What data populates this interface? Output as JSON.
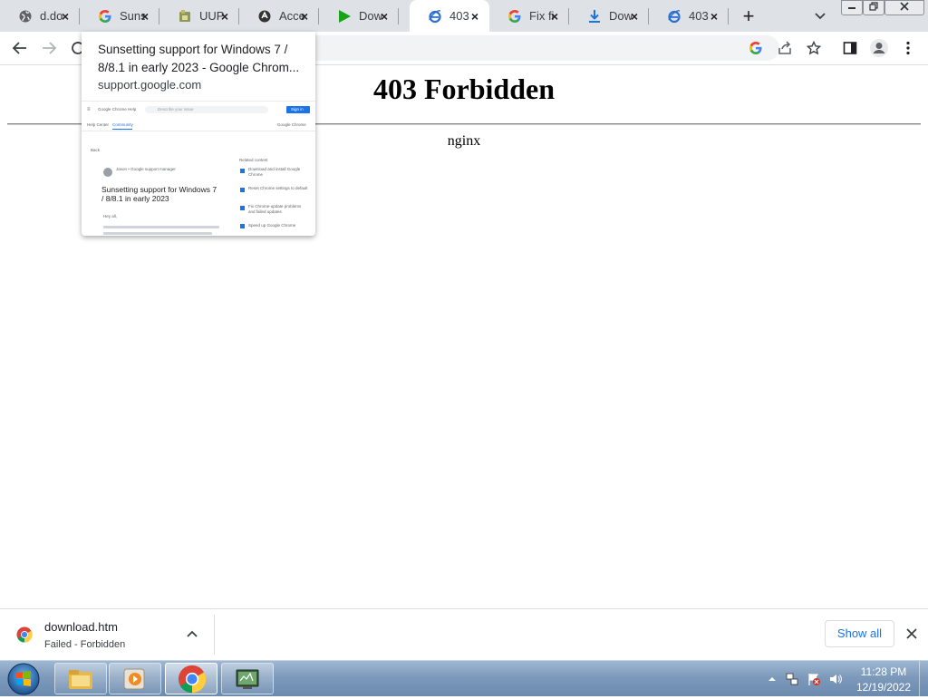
{
  "browser": {
    "tabs": [
      {
        "title": "d.do",
        "icon": "globe-icon",
        "active": false
      },
      {
        "title": "Suns",
        "icon": "google-g-icon",
        "active": false
      },
      {
        "title": "UUP",
        "icon": "uup-icon",
        "active": false
      },
      {
        "title": "Acce",
        "icon": "shield-icon",
        "active": false
      },
      {
        "title": "Dow",
        "icon": "play-icon",
        "active": false
      },
      {
        "title": "403",
        "icon": "ie-icon",
        "active": true
      },
      {
        "title": "Fix fi",
        "icon": "google-g-icon",
        "active": false
      },
      {
        "title": "Dow",
        "icon": "download-icon",
        "active": false
      },
      {
        "title": "403",
        "icon": "ie-icon",
        "active": false
      }
    ],
    "tab_close_glyph": "×",
    "new_tab_glyph": "+"
  },
  "hover_card": {
    "title": "Sunsetting support for Windows 7 / 8/8.1 in early 2023 - Google Chrom...",
    "domain": "support.google.com",
    "thumbnail": {
      "header": "Google Chrome Help",
      "search_placeholder": "Describe your issue",
      "sign_in": "Sign in",
      "tab1": "Help Center",
      "tab2": "Community",
      "right_link": "Google Chrome",
      "back": "Back",
      "author": "Jason • Google support manager",
      "article_title": "Sunsetting support for Windows 7 / 8/8.1 in early 2023",
      "greeting": "Hey all,",
      "related_header": "Related content",
      "related": [
        "Download and install Google Chrome",
        "Reset Chrome settings to default",
        "Fix Chrome-update problems and failed updates",
        "Speed up Google Chrome"
      ]
    }
  },
  "page": {
    "title": "403 Forbidden",
    "server": "nginx"
  },
  "downloads": {
    "file_name": "download.htm",
    "status": "Failed - Forbidden",
    "show_all": "Show all"
  },
  "taskbar": {
    "time": "11:28 PM",
    "date": "12/19/2022"
  },
  "colors": {
    "tabstrip": "#dee1e6",
    "accent_link": "#1a73e8",
    "taskbar": "#7d9abb"
  }
}
